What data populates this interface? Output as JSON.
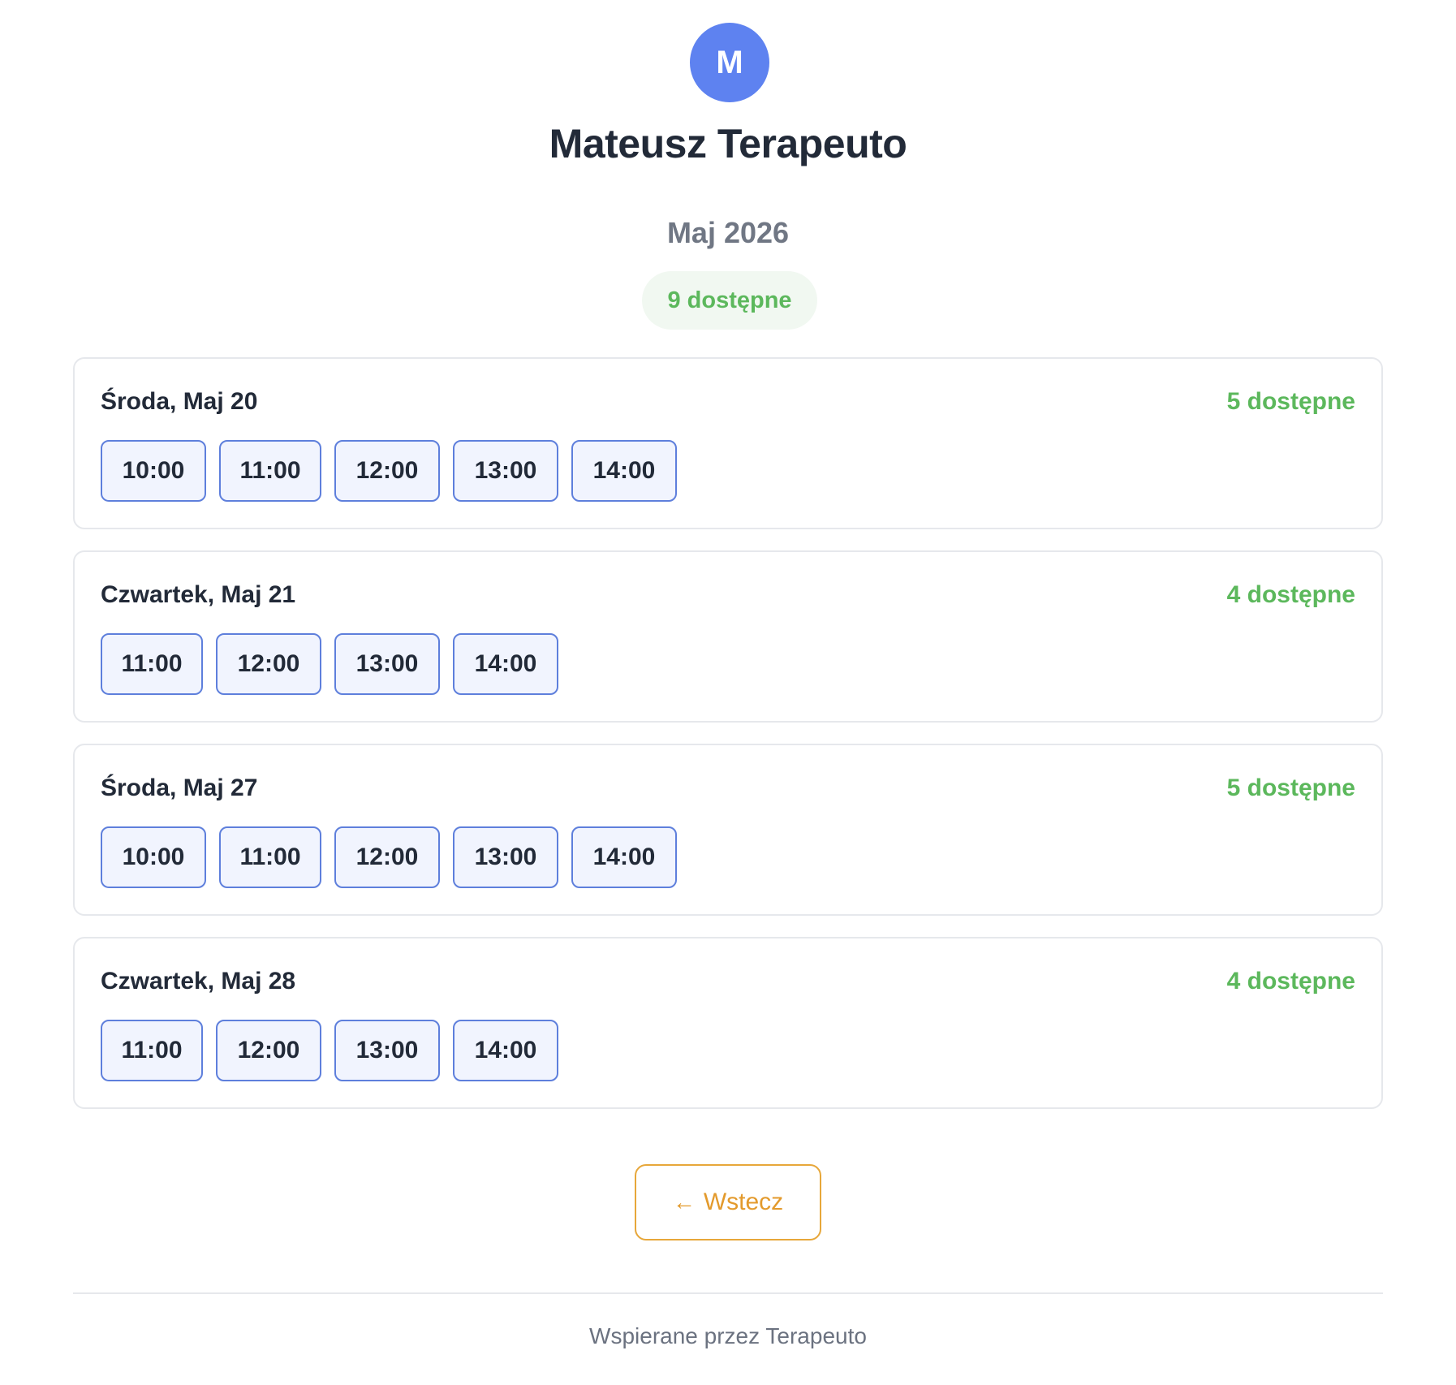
{
  "therapist": {
    "initial": "M",
    "name": "Mateusz Terapeuto"
  },
  "month": "Maj 2026",
  "summary": "9 dostępne",
  "days": [
    {
      "title": "Środa, Maj 20",
      "count": "5 dostępne",
      "slots": [
        "10:00",
        "11:00",
        "12:00",
        "13:00",
        "14:00"
      ]
    },
    {
      "title": "Czwartek, Maj 21",
      "count": "4 dostępne",
      "slots": [
        "11:00",
        "12:00",
        "13:00",
        "14:00"
      ]
    },
    {
      "title": "Środa, Maj 27",
      "count": "5 dostępne",
      "slots": [
        "10:00",
        "11:00",
        "12:00",
        "13:00",
        "14:00"
      ]
    },
    {
      "title": "Czwartek, Maj 28",
      "count": "4 dostępne",
      "slots": [
        "11:00",
        "12:00",
        "13:00",
        "14:00"
      ]
    }
  ],
  "back_button": {
    "icon": "arrow-left-icon",
    "label": "Wstecz"
  },
  "footer": "Wspierane przez Terapeuto",
  "colors": {
    "accent": "#5e82f0",
    "available": "#5cb85c",
    "back": "#e39a2c"
  }
}
